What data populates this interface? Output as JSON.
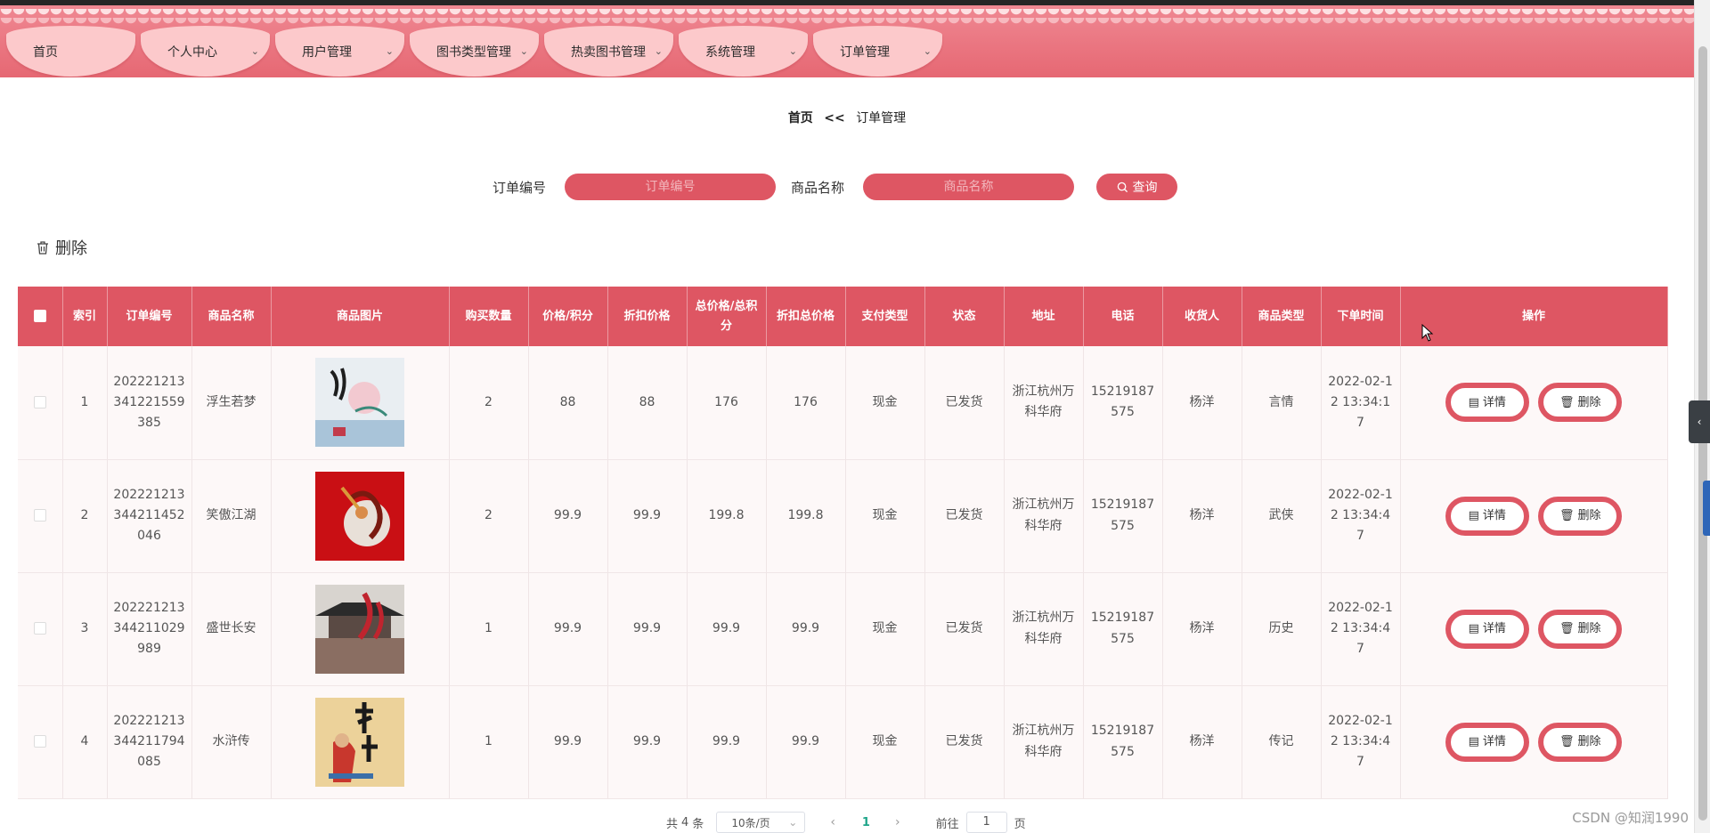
{
  "nav": {
    "tabs": [
      {
        "label": "首页",
        "has_dropdown": false
      },
      {
        "label": "个人中心",
        "has_dropdown": true
      },
      {
        "label": "用户管理",
        "has_dropdown": true
      },
      {
        "label": "图书类型管理",
        "has_dropdown": true
      },
      {
        "label": "热卖图书管理",
        "has_dropdown": true
      },
      {
        "label": "系统管理",
        "has_dropdown": true
      },
      {
        "label": "订单管理",
        "has_dropdown": true
      }
    ]
  },
  "breadcrumb": {
    "home": "首页",
    "separator": "<<",
    "current": "订单管理"
  },
  "search": {
    "order_no_label": "订单编号",
    "order_no_placeholder": "订单编号",
    "product_name_label": "商品名称",
    "product_name_placeholder": "商品名称",
    "query_label": "查询"
  },
  "toolbar": {
    "bulk_delete_label": "删除"
  },
  "table": {
    "headers": [
      "索引",
      "订单编号",
      "商品名称",
      "商品图片",
      "购买数量",
      "价格/积分",
      "折扣价格",
      "总价格/总积分",
      "折扣总价格",
      "支付类型",
      "状态",
      "地址",
      "电话",
      "收货人",
      "商品类型",
      "下单时间",
      "操作"
    ],
    "rows": [
      {
        "index": "1",
        "order_no": "202221213341221559385",
        "name": "浮生若梦",
        "image": "book-cover-浮生若梦",
        "qty": "2",
        "price": "88",
        "discount_price": "88",
        "total": "176",
        "discount_total": "176",
        "pay_type": "现金",
        "status": "已发货",
        "address": "浙江杭州万科华府",
        "phone": "15219187575",
        "receiver": "杨洋",
        "category": "言情",
        "time": "2022-02-12 13:34:17"
      },
      {
        "index": "2",
        "order_no": "202221213344211452046",
        "name": "笑傲江湖",
        "image": "book-cover-笑傲江湖",
        "qty": "2",
        "price": "99.9",
        "discount_price": "99.9",
        "total": "199.8",
        "discount_total": "199.8",
        "pay_type": "现金",
        "status": "已发货",
        "address": "浙江杭州万科华府",
        "phone": "15219187575",
        "receiver": "杨洋",
        "category": "武侠",
        "time": "2022-02-12 13:34:47"
      },
      {
        "index": "3",
        "order_no": "202221213344211029989",
        "name": "盛世长安",
        "image": "book-cover-盛世长安",
        "qty": "1",
        "price": "99.9",
        "discount_price": "99.9",
        "total": "99.9",
        "discount_total": "99.9",
        "pay_type": "现金",
        "status": "已发货",
        "address": "浙江杭州万科华府",
        "phone": "15219187575",
        "receiver": "杨洋",
        "category": "历史",
        "time": "2022-02-12 13:34:47"
      },
      {
        "index": "4",
        "order_no": "202221213344211794085",
        "name": "水浒传",
        "image": "book-cover-水浒传",
        "qty": "1",
        "price": "99.9",
        "discount_price": "99.9",
        "total": "99.9",
        "discount_total": "99.9",
        "pay_type": "现金",
        "status": "已发货",
        "address": "浙江杭州万科华府",
        "phone": "15219187575",
        "receiver": "杨洋",
        "category": "传记",
        "time": "2022-02-12 13:34:47"
      }
    ],
    "actions": {
      "detail_label": "详情",
      "delete_label": "删除"
    }
  },
  "pagination": {
    "total_prefix": "共",
    "total_count": "4",
    "total_suffix": "条",
    "page_size_label": "10条/页",
    "current_page": "1",
    "goto_label": "前往",
    "goto_value": "1",
    "page_suffix": "页"
  },
  "watermark": "CSDN @知润1990",
  "colors": {
    "primary": "#de5663",
    "nav_bg": "#ea7580",
    "nav_tab": "#fcc9cb",
    "header_text": "#ffffff",
    "active_page": "#1fa58a"
  }
}
